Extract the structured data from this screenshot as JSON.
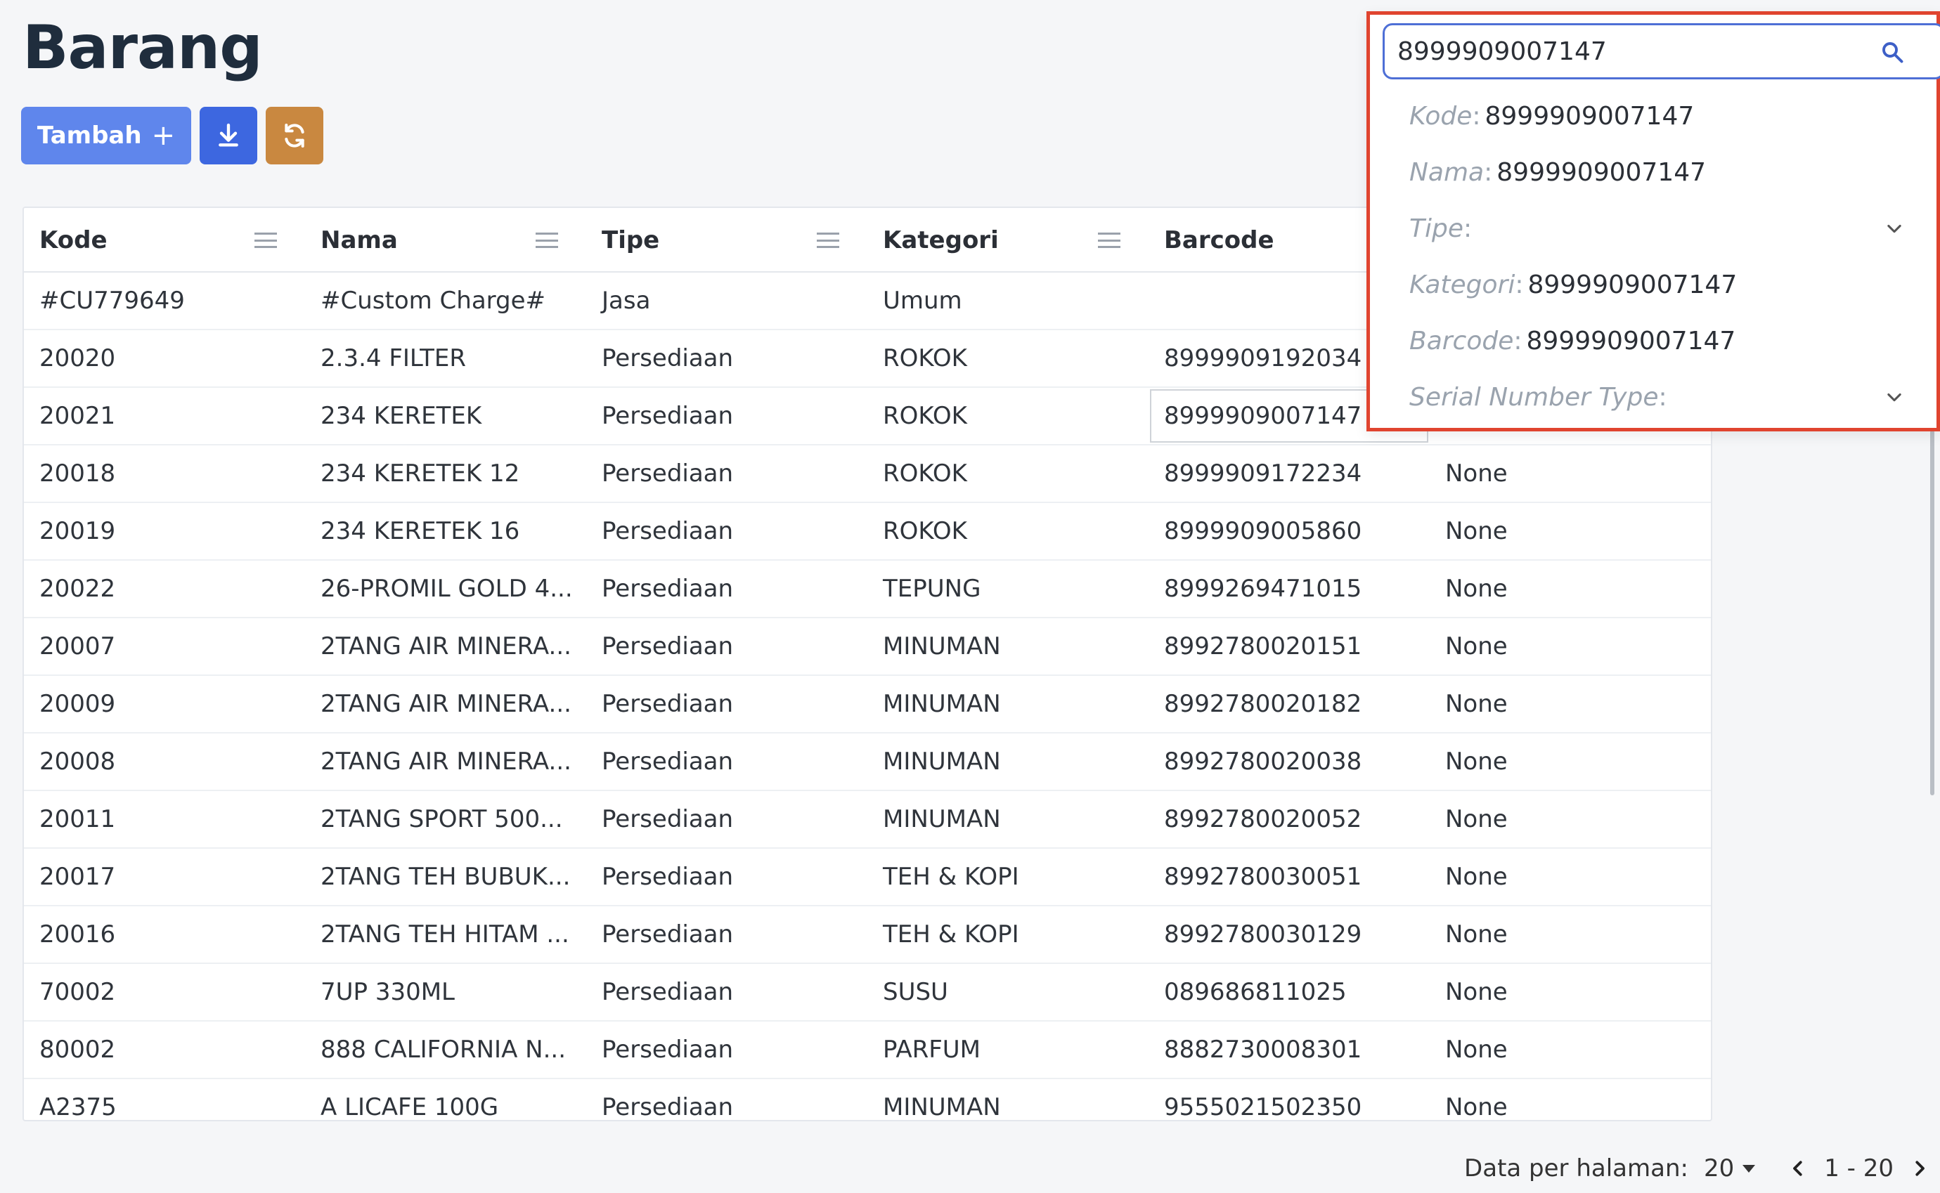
{
  "page": {
    "title": "Barang"
  },
  "toolbar": {
    "add_label": "Tambah",
    "add_icon": "plus-icon",
    "download_icon": "download-icon",
    "sync_icon": "sync-icon",
    "colors": {
      "add": "#5f86ec",
      "download": "#3d67e0",
      "sync": "#c98840"
    }
  },
  "table": {
    "columns": [
      "Kode",
      "Nama",
      "Tipe",
      "Kategori",
      "Barcode"
    ],
    "rows": [
      [
        "#CU779649",
        "#Custom Charge#",
        "Jasa",
        "Umum",
        "",
        ""
      ],
      [
        "20020",
        "2.3.4 FILTER",
        "Persediaan",
        "ROKOK",
        "8999909192034",
        ""
      ],
      [
        "20021",
        "234 KERETEK",
        "Persediaan",
        "ROKOK",
        "8999909007147",
        ""
      ],
      [
        "20018",
        "234 KERETEK 12",
        "Persediaan",
        "ROKOK",
        "8999909172234",
        "None"
      ],
      [
        "20019",
        "234 KERETEK 16",
        "Persediaan",
        "ROKOK",
        "8999909005860",
        "None"
      ],
      [
        "20022",
        "26-PROMIL GOLD 4...",
        "Persediaan",
        "TEPUNG",
        "8999269471015",
        "None"
      ],
      [
        "20007",
        "2TANG AIR MINERA...",
        "Persediaan",
        "MINUMAN",
        "8992780020151",
        "None"
      ],
      [
        "20009",
        "2TANG AIR MINERA...",
        "Persediaan",
        "MINUMAN",
        "8992780020182",
        "None"
      ],
      [
        "20008",
        "2TANG AIR MINERA...",
        "Persediaan",
        "MINUMAN",
        "8992780020038",
        "None"
      ],
      [
        "20011",
        "2TANG SPORT 500...",
        "Persediaan",
        "MINUMAN",
        "8992780020052",
        "None"
      ],
      [
        "20017",
        "2TANG TEH BUBUK...",
        "Persediaan",
        "TEH & KOPI",
        "8992780030051",
        "None"
      ],
      [
        "20016",
        "2TANG TEH HITAM ...",
        "Persediaan",
        "TEH & KOPI",
        "8992780030129",
        "None"
      ],
      [
        "70002",
        "7UP 330ML",
        "Persediaan",
        "SUSU",
        "089686811025",
        "None"
      ],
      [
        "80002",
        "888 CALIFORNIA N...",
        "Persediaan",
        "PARFUM",
        "8882730008301",
        "None"
      ],
      [
        "A2375",
        "A LICAFE 100G",
        "Persediaan",
        "MINUMAN",
        "9555021502350",
        "None"
      ]
    ]
  },
  "footer": {
    "per_page_label": "Data per halaman:",
    "per_page_value": "20",
    "range": "1 - 20"
  },
  "search": {
    "value": "8999909007147",
    "icon": "search-icon",
    "border_color": "#e0442f",
    "options": [
      {
        "label": "Kode",
        "value": "8999909007147",
        "dropdown": false
      },
      {
        "label": "Nama",
        "value": "8999909007147",
        "dropdown": false
      },
      {
        "label": "Tipe",
        "value": "",
        "dropdown": true
      },
      {
        "label": "Kategori",
        "value": "8999909007147",
        "dropdown": false
      },
      {
        "label": "Barcode",
        "value": "8999909007147",
        "dropdown": false
      },
      {
        "label": "Serial Number Type",
        "value": "",
        "dropdown": true
      }
    ]
  }
}
